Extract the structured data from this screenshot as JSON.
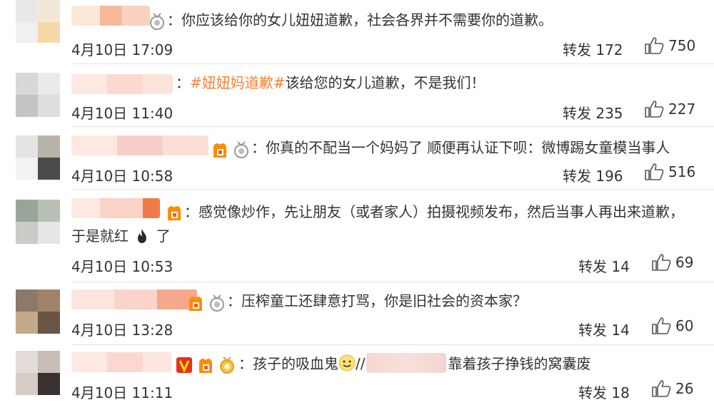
{
  "comments": [
    {
      "text": "：你应该给你的女儿妞妞道歉，社会各界并不需要你的道歉。",
      "date": "4月10日 17:09",
      "repost": "转发 172",
      "likes": "750"
    },
    {
      "tag": "#妞妞妈道歉#",
      "text": "该给您的女儿道歉，不是我们！",
      "date": "4月10日 11:40",
      "repost": "转发 235",
      "likes": "227"
    },
    {
      "text": "：你真的不配当一个妈妈了 顺便再认证下呗：微博踢女童模当事人",
      "date": "4月10日 10:58",
      "repost": "转发 196",
      "likes": "516"
    },
    {
      "text": "：感觉像炒作，先让朋友（或者家人）拍摄视频发布，然后当事人再出来道歉，",
      "text2a": "于是就红",
      "text2b": "了",
      "date": "4月10日 10:53",
      "repost": "转发 14",
      "likes": "69"
    },
    {
      "text": "：压榨童工还肆意打骂，你是旧社会的资本家？",
      "date": "4月10日 13:28",
      "repost": "转发 14",
      "likes": "60"
    },
    {
      "text": "：孩子的吸血鬼",
      "sep": "//",
      "text_after": "靠着孩子挣钱的窝囊废",
      "date": "4月10日 11:11",
      "repost": "转发 18",
      "likes": "26"
    }
  ],
  "icons": {
    "like": "thumbs-up-icon",
    "badge": "medal-icon",
    "vip": "vip-v-icon",
    "fan": "fan-badge-icon",
    "fire": "fire-icon",
    "emoji": "smiling-face-icon"
  },
  "colors": {
    "text": "#333333",
    "tag": "#ff7f33",
    "divider": "#e6e6e6",
    "vip": "#ff8c00"
  }
}
